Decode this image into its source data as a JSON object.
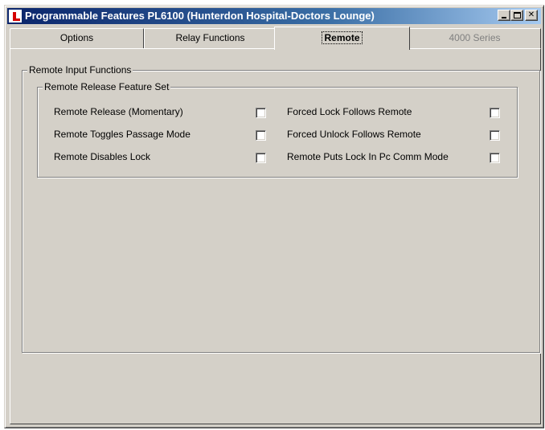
{
  "window": {
    "title": "Programmable Features PL6100 (Hunterdon Hospital-Doctors Lounge)",
    "icon": "app-logo-icon",
    "controls": [
      "minimize",
      "maximize",
      "close"
    ]
  },
  "tabs": [
    {
      "label": "Options",
      "active": false,
      "enabled": true
    },
    {
      "label": "Relay Functions",
      "active": false,
      "enabled": true
    },
    {
      "label": "Remote",
      "active": true,
      "enabled": true
    },
    {
      "label": "4000 Series",
      "active": false,
      "enabled": false
    }
  ],
  "remote_input": {
    "group_title": "Remote Input Functions",
    "feature_set": {
      "group_title": "Remote Release Feature Set",
      "left_options": [
        {
          "label": "Remote Release (Momentary)",
          "checked": false
        },
        {
          "label": "Remote Toggles Passage Mode",
          "checked": false
        },
        {
          "label": "Remote Disables Lock",
          "checked": false
        }
      ],
      "right_options": [
        {
          "label": "Forced Lock Follows Remote",
          "checked": false
        },
        {
          "label": "Forced Unlock Follows Remote",
          "checked": false
        },
        {
          "label": "Remote Puts Lock In  Pc Comm Mode",
          "checked": false
        }
      ]
    }
  }
}
